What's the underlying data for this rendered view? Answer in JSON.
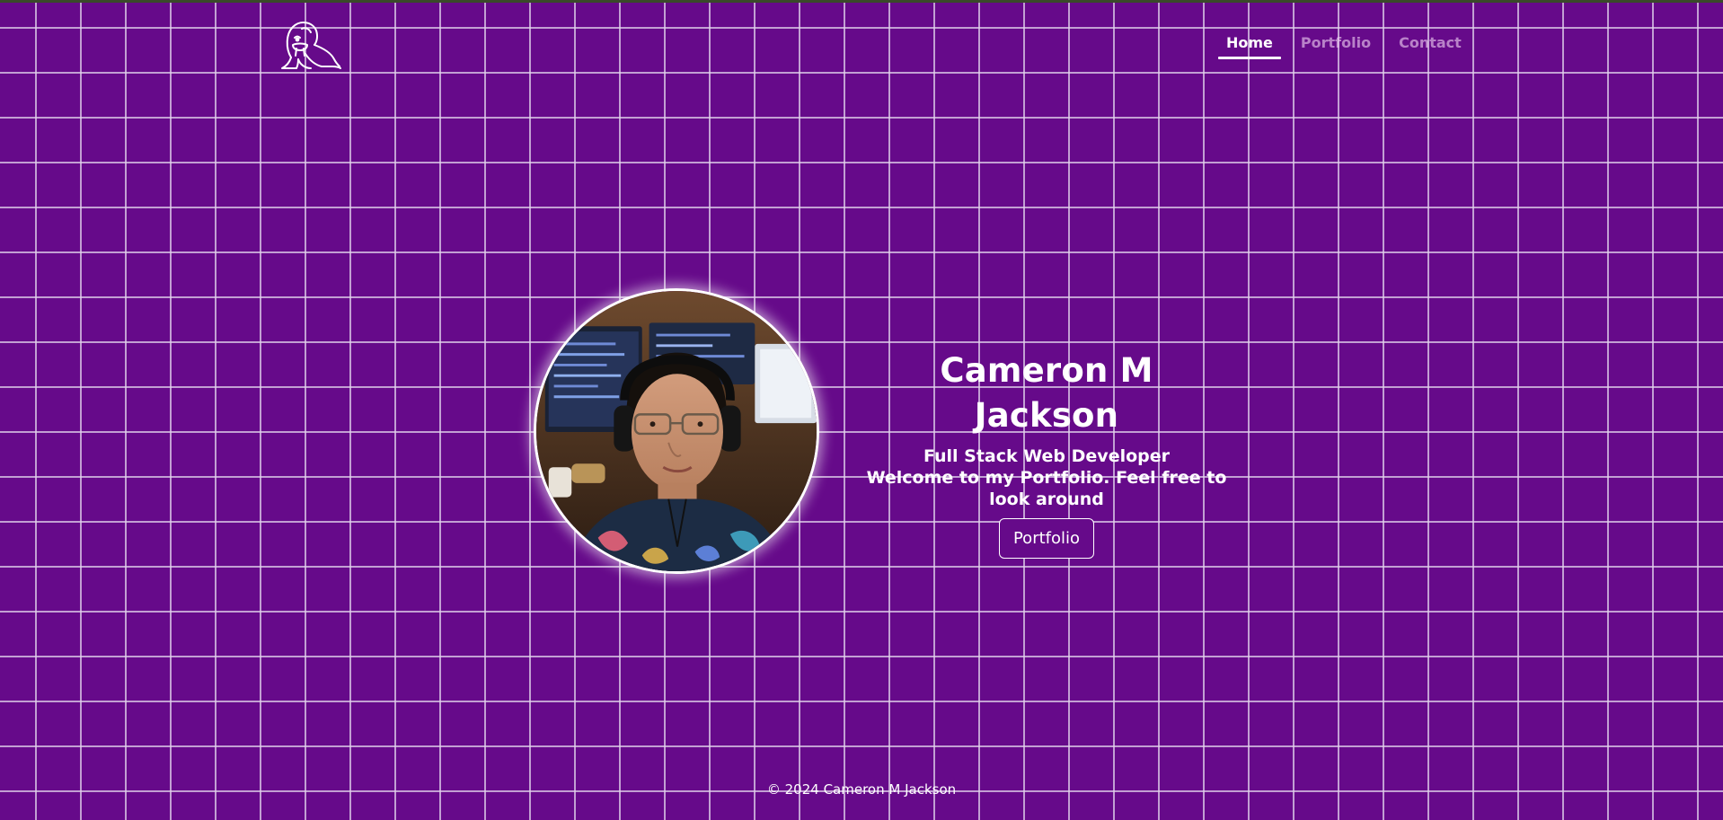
{
  "header": {
    "logo_icon": "walrus-logo-icon",
    "nav": [
      {
        "label": "Home",
        "active": true
      },
      {
        "label": "Portfolio",
        "active": false
      },
      {
        "label": "Contact",
        "active": false
      }
    ]
  },
  "hero": {
    "avatar_icon": "profile-photo",
    "name": "Cameron M Jackson",
    "role": "Full Stack Web Developer",
    "welcome": "Welcome to my Portfolio. Feel free to look around",
    "button_label": "Portfolio"
  },
  "footer": {
    "copyright": "© 2024 Cameron M Jackson"
  },
  "colors": {
    "background": "#660a8a",
    "grid_line": "#e1d2eb",
    "text": "#ffffff",
    "nav_inactive": "#c58ad6"
  }
}
